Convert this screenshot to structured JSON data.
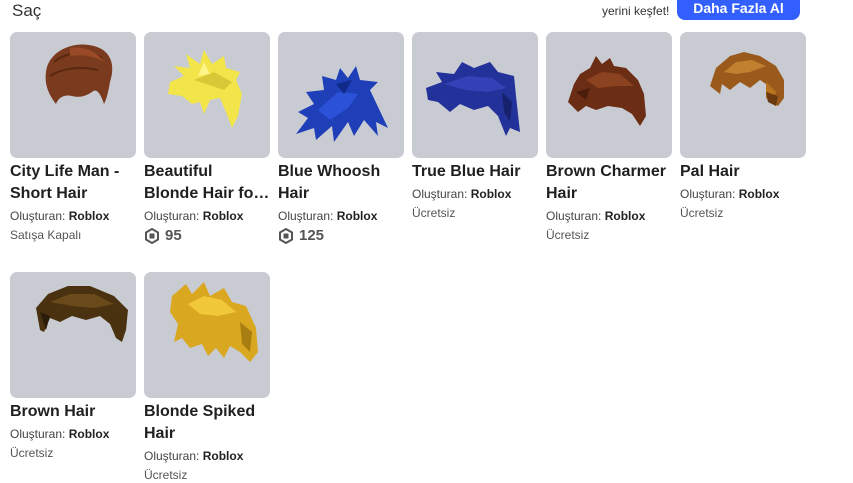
{
  "header": {
    "section_title": "Saç",
    "promo_text": "yerini keşfet!",
    "more_button_label": "Daha Fazla Al"
  },
  "colors": {
    "accent": "#335fff",
    "thumb_bg": "#c9cbd3"
  },
  "items": [
    {
      "name": "City Life Man - Short Hair",
      "creator_prefix": "Oluşturan:",
      "creator": "Roblox",
      "status": "Satışa Kapalı"
    },
    {
      "name": "Beautiful Blonde Hair fo…",
      "creator_prefix": "Oluşturan:",
      "creator": "Roblox",
      "price": "95",
      "price_icon": "robux-icon"
    },
    {
      "name": "Blue Whoosh Hair",
      "creator_prefix": "Oluşturan:",
      "creator": "Roblox",
      "price": "125",
      "price_icon": "robux-icon"
    },
    {
      "name": "True Blue Hair",
      "creator_prefix": "Oluşturan:",
      "creator": "Roblox",
      "status": "Ücretsiz"
    },
    {
      "name": "Brown Charmer Hair",
      "creator_prefix": "Oluşturan:",
      "creator": "Roblox",
      "status": "Ücretsiz"
    },
    {
      "name": "Pal Hair",
      "creator_prefix": "Oluşturan:",
      "creator": "Roblox",
      "status": "Ücretsiz"
    },
    {
      "name": "Brown Hair",
      "creator_prefix": "Oluşturan:",
      "creator": "Roblox",
      "status": "Ücretsiz"
    },
    {
      "name": "Blonde Spiked Hair",
      "creator_prefix": "Oluşturan:",
      "creator": "Roblox",
      "status": "Ücretsiz"
    }
  ]
}
